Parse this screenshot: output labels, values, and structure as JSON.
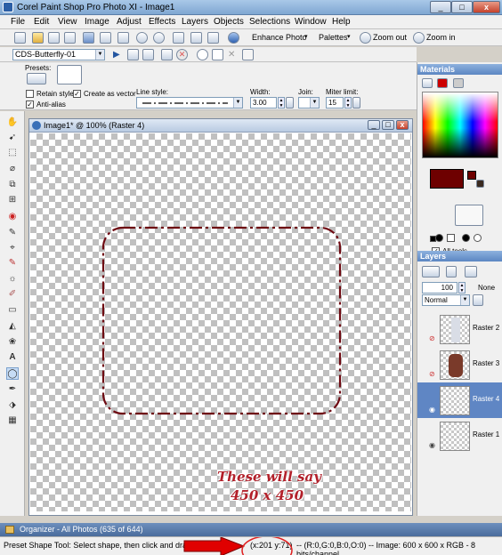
{
  "window": {
    "title": "Corel Paint Shop Pro Photo XI - Image1",
    "min": "_",
    "max": "□",
    "close": "x"
  },
  "menu": [
    "File",
    "Edit",
    "View",
    "Image",
    "Adjust",
    "Effects",
    "Layers",
    "Objects",
    "Selections",
    "Window",
    "Help"
  ],
  "toolbar": {
    "enhance": "Enhance Photo",
    "palettes": "Palettes",
    "zoom_out": "Zoom out",
    "zoom_in": "Zoom in"
  },
  "shape_combo": "CDS-Butterfly-01",
  "options": {
    "presets": "Presets:",
    "retain_style": "Retain style",
    "create_vector": "Create as vector",
    "anti_alias": "Anti-alias",
    "line_style": "Line style:",
    "width_label": "Width:",
    "width_value": "3.00",
    "join_label": "Join:",
    "miter_label": "Miter limit:",
    "miter_value": "15"
  },
  "document": {
    "title": "Image1* @ 100% (Raster 4)"
  },
  "annotation": {
    "line1": "These will say",
    "line2": "450 x 450"
  },
  "materials": {
    "header": "Materials",
    "all_tools": "All tools"
  },
  "layers_panel": {
    "header": "Layers",
    "opacity": "100",
    "mode": "Normal",
    "blend": "None",
    "items": [
      {
        "name": "Raster 2"
      },
      {
        "name": "Raster 3"
      },
      {
        "name": "Raster 4"
      },
      {
        "name": "Raster 1"
      }
    ]
  },
  "organizer": "Organizer - All Photos (635 of 644)",
  "status": {
    "hint": "Preset Shape Tool: Select shape, then click and drag to",
    "coords": "(x:201 y:71)",
    "info": "-- (R:0,G:0,B:0,O:0) -- Image: 600 x 600 x RGB - 8 bits/channel"
  },
  "colors": {
    "foreground": "#6e0000",
    "shape_stroke": "#6e0a12",
    "annotation": "#b2202a",
    "highlight_arrow": "#e00000"
  }
}
